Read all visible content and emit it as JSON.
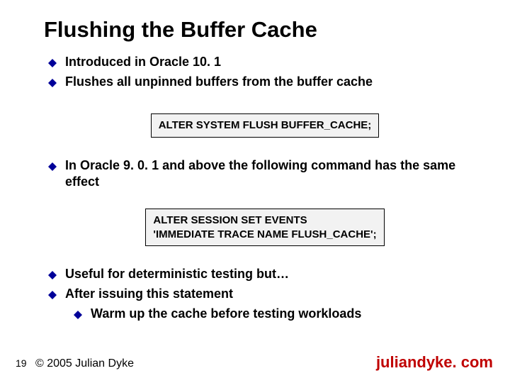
{
  "title": "Flushing the Buffer Cache",
  "bullets": {
    "b0": "Introduced in Oracle 10. 1",
    "b1": "Flushes all unpinned buffers from the buffer cache",
    "b2": "In Oracle 9. 0. 1 and above the following command has the same effect",
    "b3": "Useful for deterministic testing but…",
    "b4": "After issuing this statement",
    "b5": "Warm up the cache before testing workloads"
  },
  "code": {
    "c0": "ALTER SYSTEM FLUSH BUFFER_CACHE;",
    "c1a": "ALTER SESSION SET EVENTS",
    "c1b": "'IMMEDIATE TRACE NAME FLUSH_CACHE';"
  },
  "footer": {
    "page": "19",
    "copyright": "© 2005 Julian Dyke",
    "site": "juliandyke. com"
  },
  "colors": {
    "bullet": "#000099",
    "site": "#c00000"
  }
}
